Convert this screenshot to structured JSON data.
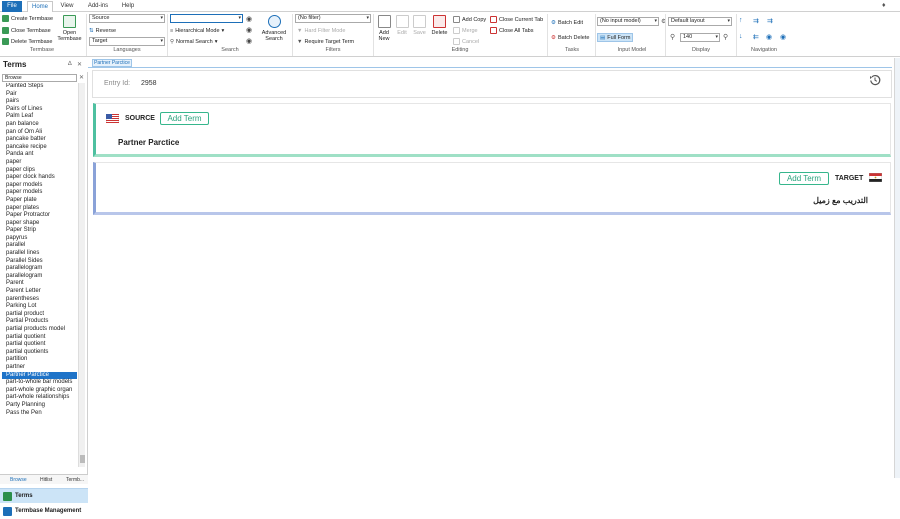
{
  "menubar": {
    "tabs": [
      "File",
      "Home",
      "View",
      "Add-ins",
      "Help"
    ]
  },
  "ribbon": {
    "termbase": {
      "create": "Create Termbase",
      "close": "Close Termbase",
      "delete": "Delete Termbase",
      "open_line1": "Open",
      "open_line2": "Termbase",
      "label": "Termbase"
    },
    "languages": {
      "source": "Source",
      "reverse": "Reverse",
      "target": "Target",
      "label": "Languages"
    },
    "search": {
      "query": "",
      "hierarchical": "Hierarchical Mode",
      "normal": "Normal Search",
      "advanced_line1": "Advanced",
      "advanced_line2": "Search",
      "label": "Search"
    },
    "filters": {
      "filter_value": "(No filter)",
      "hard_filter": "Hard Filter Mode",
      "require_target": "Require Target Term",
      "label": "Filters"
    },
    "editing": {
      "add_new_line1": "Add",
      "add_new_line2": "New",
      "edit": "Edit",
      "save": "Save",
      "delete": "Delete",
      "add_copy": "Add Copy",
      "merge": "Merge",
      "cancel": "Cancel",
      "close_current_tab": "Close Current Tab",
      "close_all_tabs": "Close All Tabs",
      "label": "Editing"
    },
    "tasks": {
      "batch_edit": "Batch Edit",
      "batch_delete": "Batch Delete",
      "label": "Tasks"
    },
    "input_model": {
      "value": "(No input model)",
      "full_form": "Full Form",
      "label": "Input Model"
    },
    "display": {
      "layout": "Default layout",
      "zoom": "140",
      "label": "Display"
    },
    "navigation": {
      "label": "Navigation"
    }
  },
  "left_panel": {
    "title": "Terms",
    "search_value": "Browse",
    "terms": [
      "Painted Steps",
      "Pair",
      "pairs",
      "Pairs of Lines",
      "Palm Leaf",
      "pan balance",
      "pan of Om Ali",
      "pancake batter",
      "pancake recipe",
      "Panda ant",
      "paper",
      "paper clips",
      "paper clock hands",
      "paper models",
      "paper models",
      "Paper plate",
      "paper plates",
      "Paper Protractor",
      "paper shape",
      "Paper Strip",
      "papyrus",
      "parallel",
      "parallel lines",
      "Parallel Sides",
      "parallelogram",
      "parallelogram",
      "Parent",
      "Parent Letter",
      "parentheses",
      "Parking Lot",
      "partial product",
      "Partial Products",
      "partial products model",
      "partial quotient",
      "partial quotient",
      "partial quotients",
      "partition",
      "partner",
      "Partner Parctice",
      "part-to-whole bar models",
      "part-whole graphic organ",
      "part-whole relationships",
      "Party Planning",
      "Pass the Pen"
    ],
    "selected_index": 38,
    "tabs": [
      "Browse",
      "Hitlist",
      "Termb..."
    ],
    "nav_terms": "Terms",
    "nav_termbase_management": "Termbase Management"
  },
  "document": {
    "tab_title": "Partner Parctice",
    "entry_id_label": "Entry Id:",
    "entry_id": "2958",
    "source": {
      "language_label": "SOURCE",
      "add_term": "Add Term",
      "term": "Partner Parctice"
    },
    "target": {
      "language_label": "TARGET",
      "add_term": "Add Term",
      "term": "التدريب مع زميل"
    }
  },
  "colors": {
    "accent_blue": "#1d6fb8",
    "selection": "#1e73c8",
    "source_border": "#4ec0a0",
    "target_border": "#8aa2d8",
    "add_term_green": "#2aa37d"
  }
}
